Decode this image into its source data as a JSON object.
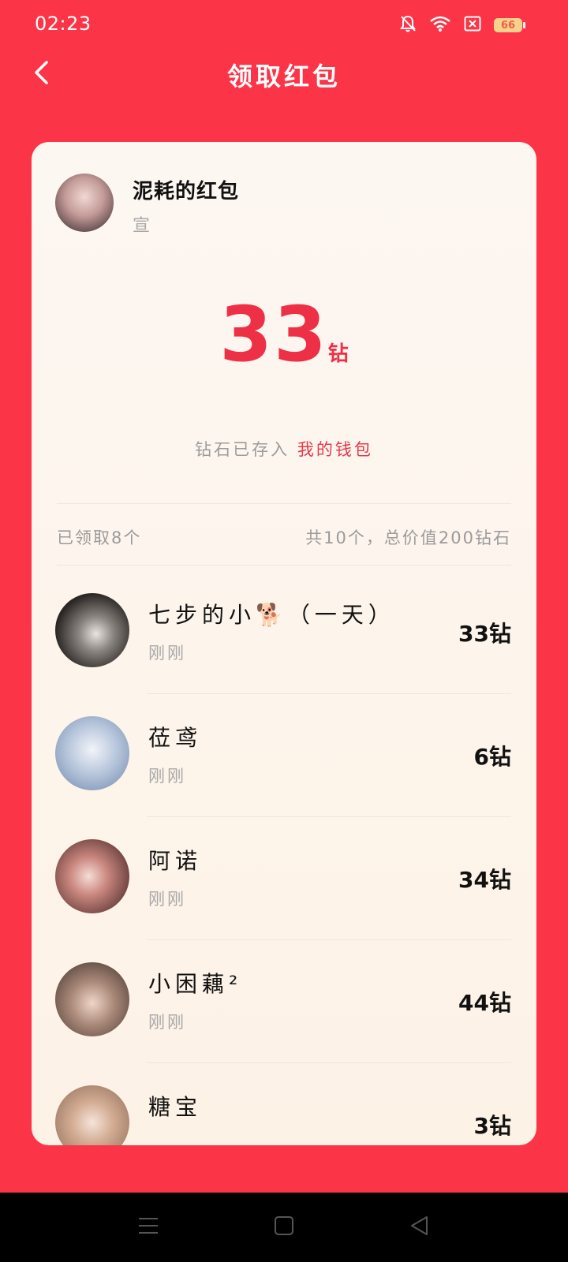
{
  "status_bar": {
    "time": "02:23",
    "battery_level": "66",
    "icons": [
      "bell-muted-icon",
      "wifi-icon",
      "sim-off-icon",
      "battery-icon"
    ]
  },
  "header": {
    "title": "领取红包",
    "back_icon": "chevron-left-icon"
  },
  "sender": {
    "title": "泥耗的红包",
    "subtitle": "宣"
  },
  "amount": {
    "value": "33",
    "unit": "钻"
  },
  "wallet": {
    "text": "钻石已存入",
    "link": "我的钱包"
  },
  "summary": {
    "received": "已领取8个",
    "total": "共10个，总价值200钻石"
  },
  "recipients": [
    {
      "name": "七步的小🐕（一天）",
      "time": "刚刚",
      "amount": "33钻"
    },
    {
      "name": "莅鸢",
      "time": "刚刚",
      "amount": "6钻"
    },
    {
      "name": "阿诺",
      "time": "刚刚",
      "amount": "34钻"
    },
    {
      "name": "小困藕²",
      "time": "刚刚",
      "amount": "44钻"
    },
    {
      "name": "糖宝",
      "time": "",
      "amount": "3钻"
    }
  ],
  "colors": {
    "background": "#fb3447",
    "card": "#fdf5ed",
    "accent": "#ee3046"
  },
  "system_nav": {
    "icons": [
      "menu-icon",
      "home-icon",
      "back-triangle-icon"
    ]
  }
}
